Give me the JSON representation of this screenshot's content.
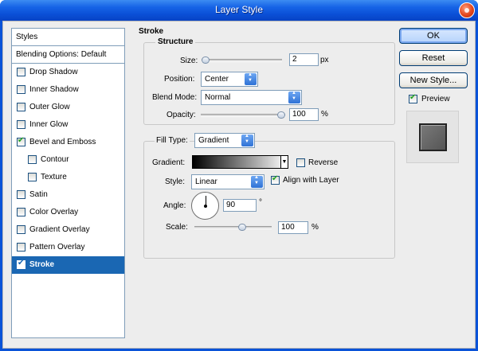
{
  "window": {
    "title": "Layer Style"
  },
  "sidebar": {
    "header": "Styles",
    "items": [
      {
        "label": "Blending Options: Default",
        "checkbox": false,
        "checked": false,
        "selected": false,
        "indent": false
      },
      {
        "label": "Drop Shadow",
        "checkbox": true,
        "checked": false,
        "selected": false,
        "indent": false
      },
      {
        "label": "Inner Shadow",
        "checkbox": true,
        "checked": false,
        "selected": false,
        "indent": false
      },
      {
        "label": "Outer Glow",
        "checkbox": true,
        "checked": false,
        "selected": false,
        "indent": false
      },
      {
        "label": "Inner Glow",
        "checkbox": true,
        "checked": false,
        "selected": false,
        "indent": false
      },
      {
        "label": "Bevel and Emboss",
        "checkbox": true,
        "checked": true,
        "selected": false,
        "indent": false
      },
      {
        "label": "Contour",
        "checkbox": true,
        "checked": false,
        "selected": false,
        "indent": true
      },
      {
        "label": "Texture",
        "checkbox": true,
        "checked": false,
        "selected": false,
        "indent": true
      },
      {
        "label": "Satin",
        "checkbox": true,
        "checked": false,
        "selected": false,
        "indent": false
      },
      {
        "label": "Color Overlay",
        "checkbox": true,
        "checked": false,
        "selected": false,
        "indent": false
      },
      {
        "label": "Gradient Overlay",
        "checkbox": true,
        "checked": false,
        "selected": false,
        "indent": false
      },
      {
        "label": "Pattern Overlay",
        "checkbox": true,
        "checked": false,
        "selected": false,
        "indent": false
      },
      {
        "label": "Stroke",
        "checkbox": true,
        "checked": true,
        "selected": true,
        "indent": false
      }
    ]
  },
  "stroke": {
    "title": "Stroke",
    "structure_title": "Structure",
    "size": {
      "label": "Size:",
      "value": "2",
      "unit": "px"
    },
    "position": {
      "label": "Position:",
      "value": "Center"
    },
    "blend_mode": {
      "label": "Blend Mode:",
      "value": "Normal"
    },
    "opacity": {
      "label": "Opacity:",
      "value": "100",
      "unit": "%"
    },
    "fill_type": {
      "label": "Fill Type:",
      "value": "Gradient"
    },
    "gradient": {
      "label": "Gradient:",
      "reverse_label": "Reverse",
      "reverse_checked": false
    },
    "style": {
      "label": "Style:",
      "value": "Linear",
      "align_label": "Align with Layer",
      "align_checked": true
    },
    "angle": {
      "label": "Angle:",
      "value": "90",
      "unit": "°"
    },
    "scale": {
      "label": "Scale:",
      "value": "100",
      "unit": "%"
    }
  },
  "buttons": {
    "ok": "OK",
    "reset": "Reset",
    "new_style": "New Style...",
    "preview_label": "Preview",
    "preview_checked": true
  }
}
